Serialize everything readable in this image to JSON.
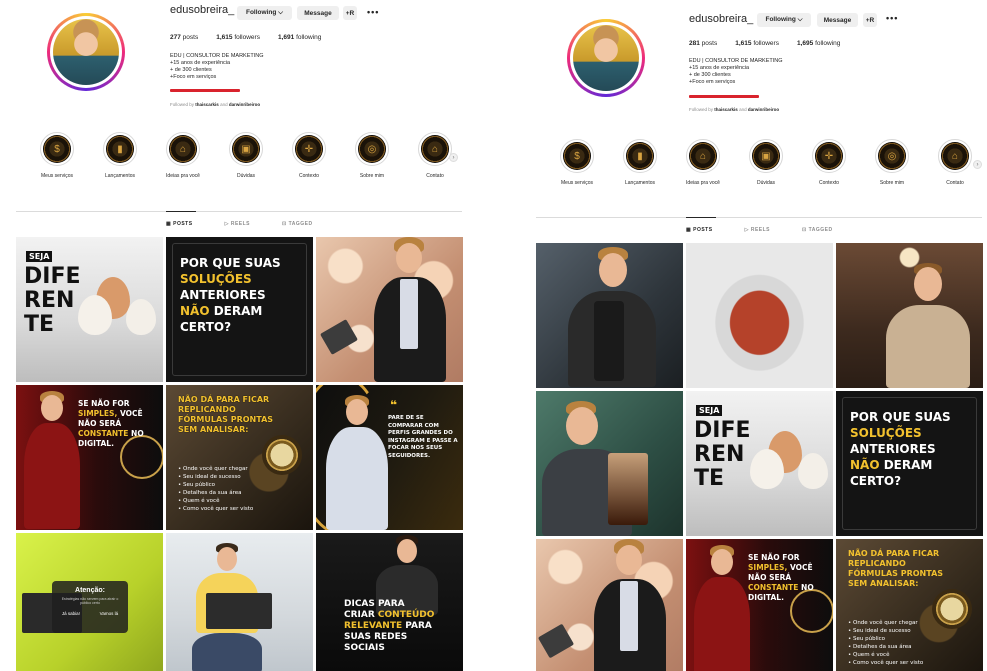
{
  "left": {
    "username": "edusobreira_",
    "buttons": {
      "following": "Following ⌵",
      "message": "Message",
      "add": "+R",
      "more": "•••"
    },
    "stats": {
      "posts": "277",
      "posts_label": "posts",
      "followers": "1,615",
      "followers_label": "followers",
      "following": "1,691",
      "following_label": "following"
    },
    "bio": {
      "title": "EDU | CONSULTOR DE MARKETING",
      "line1": "+15 anos de experiência",
      "line2": "+ de 300 clientes",
      "line3": "+Foco em serviços"
    },
    "followed_by": {
      "prefix": "Followed by",
      "user1": "thaiscarkis",
      "and": "and",
      "user2": "darwinribeiroo"
    },
    "highlights": [
      "Meus serviços",
      "Lançamentos",
      "Ideias pra você",
      "Dúvidas",
      "Contexto",
      "Sobre mim",
      "Contato"
    ],
    "tabs": {
      "posts": "POSTS",
      "reels": "REELS",
      "tagged": "TAGGED"
    },
    "posts": {
      "p1": {
        "tag": "SEJA",
        "big": "DIFE\nREN\nTE"
      },
      "p2": {
        "l1": "POR QUE SUAS",
        "l2": "SOLUÇÕES",
        "l3": "ANTERIORES",
        "l4": "NÃO",
        "l5": "DERAM",
        "l6": "CERTO?"
      },
      "p4": {
        "l1": "SE NÃO FOR",
        "l2": "SIMPLES,",
        "l3": "VOCÊ",
        "l4": "NÃO SERÁ",
        "l5": "CONSTANTE",
        "l6": "NO",
        "l7": "DIGITAL."
      },
      "p5": {
        "title": "NÃO DÁ PARA FICAR REPLICANDO FÓRMULAS PRONTAS SEM ANALISAR:",
        "items": [
          "• Onde você quer chegar",
          "• Seu ideal de sucesso",
          "• Seu público",
          "• Detalhes da sua área",
          "• Quem é você",
          "• Como você quer ser visto"
        ]
      },
      "p6": {
        "quote": "PARE DE SE COMPARAR COM PERFIS GRANDES DO INSTAGRAM E PASSE A FOCAR NOS SEUS SEGUIDORES."
      },
      "p7": {
        "title": "Atenção:",
        "body": "Estratégias não servem para atrair o público certo",
        "b1": "Já sabia!",
        "b2": "Vamos lá"
      },
      "p9": {
        "l1": "DICAS PARA",
        "l2": "CRIAR",
        "l3": "CONTEÚDO",
        "l4": "RELEVANTE",
        "l5": "PARA",
        "l6": "SUAS REDES",
        "l7": "SOCIAIS"
      }
    }
  },
  "right": {
    "username": "edusobreira_",
    "buttons": {
      "following": "Following ⌵",
      "message": "Message",
      "add": "+R",
      "more": "•••"
    },
    "stats": {
      "posts": "281",
      "posts_label": "posts",
      "followers": "1,615",
      "followers_label": "followers",
      "following": "1,695",
      "following_label": "following"
    },
    "bio": {
      "title": "EDU | CONSULTOR DE MARKETING",
      "line1": "+15 anos de experiência",
      "line2": "+ de 300 clientes",
      "line3": "+Foco em serviços"
    },
    "followed_by": {
      "prefix": "Followed by",
      "user1": "thaiscarkis",
      "and": "and",
      "user2": "darwinribeiroo"
    },
    "highlights": [
      "Meus serviços",
      "Lançamentos",
      "Ideias pra você",
      "Dúvidas",
      "Contexto",
      "Sobre mim",
      "Contato"
    ],
    "tabs": {
      "posts": "POSTS",
      "reels": "REELS",
      "tagged": "TAGGED"
    },
    "posts": {
      "p5": {
        "tag": "SEJA",
        "big": "DIFE\nREN\nTE"
      },
      "p6": {
        "l1": "POR QUE SUAS",
        "l2": "SOLUÇÕES",
        "l3": "ANTERIORES",
        "l4": "NÃO",
        "l5": "DERAM",
        "l6": "CERTO?"
      },
      "p8": {
        "l1": "SE NÃO FOR",
        "l2": "SIMPLES,",
        "l3": "VOCÊ",
        "l4": "NÃO SERÁ",
        "l5": "CONSTANTE",
        "l6": "NO",
        "l7": "DIGITAL."
      },
      "p9": {
        "title": "NÃO DÁ PARA FICAR REPLICANDO FÓRMULAS PRONTAS SEM ANALISAR:",
        "items": [
          "• Onde você quer chegar",
          "• Seu ideal de sucesso",
          "• Seu público",
          "• Detalhes da sua área",
          "• Quem é você",
          "• Como você quer ser visto"
        ]
      }
    }
  },
  "colors": {
    "accent_yellow": "#f2c12e",
    "ring_pink": "#ee2a7b",
    "underline_red": "#d9232d"
  }
}
